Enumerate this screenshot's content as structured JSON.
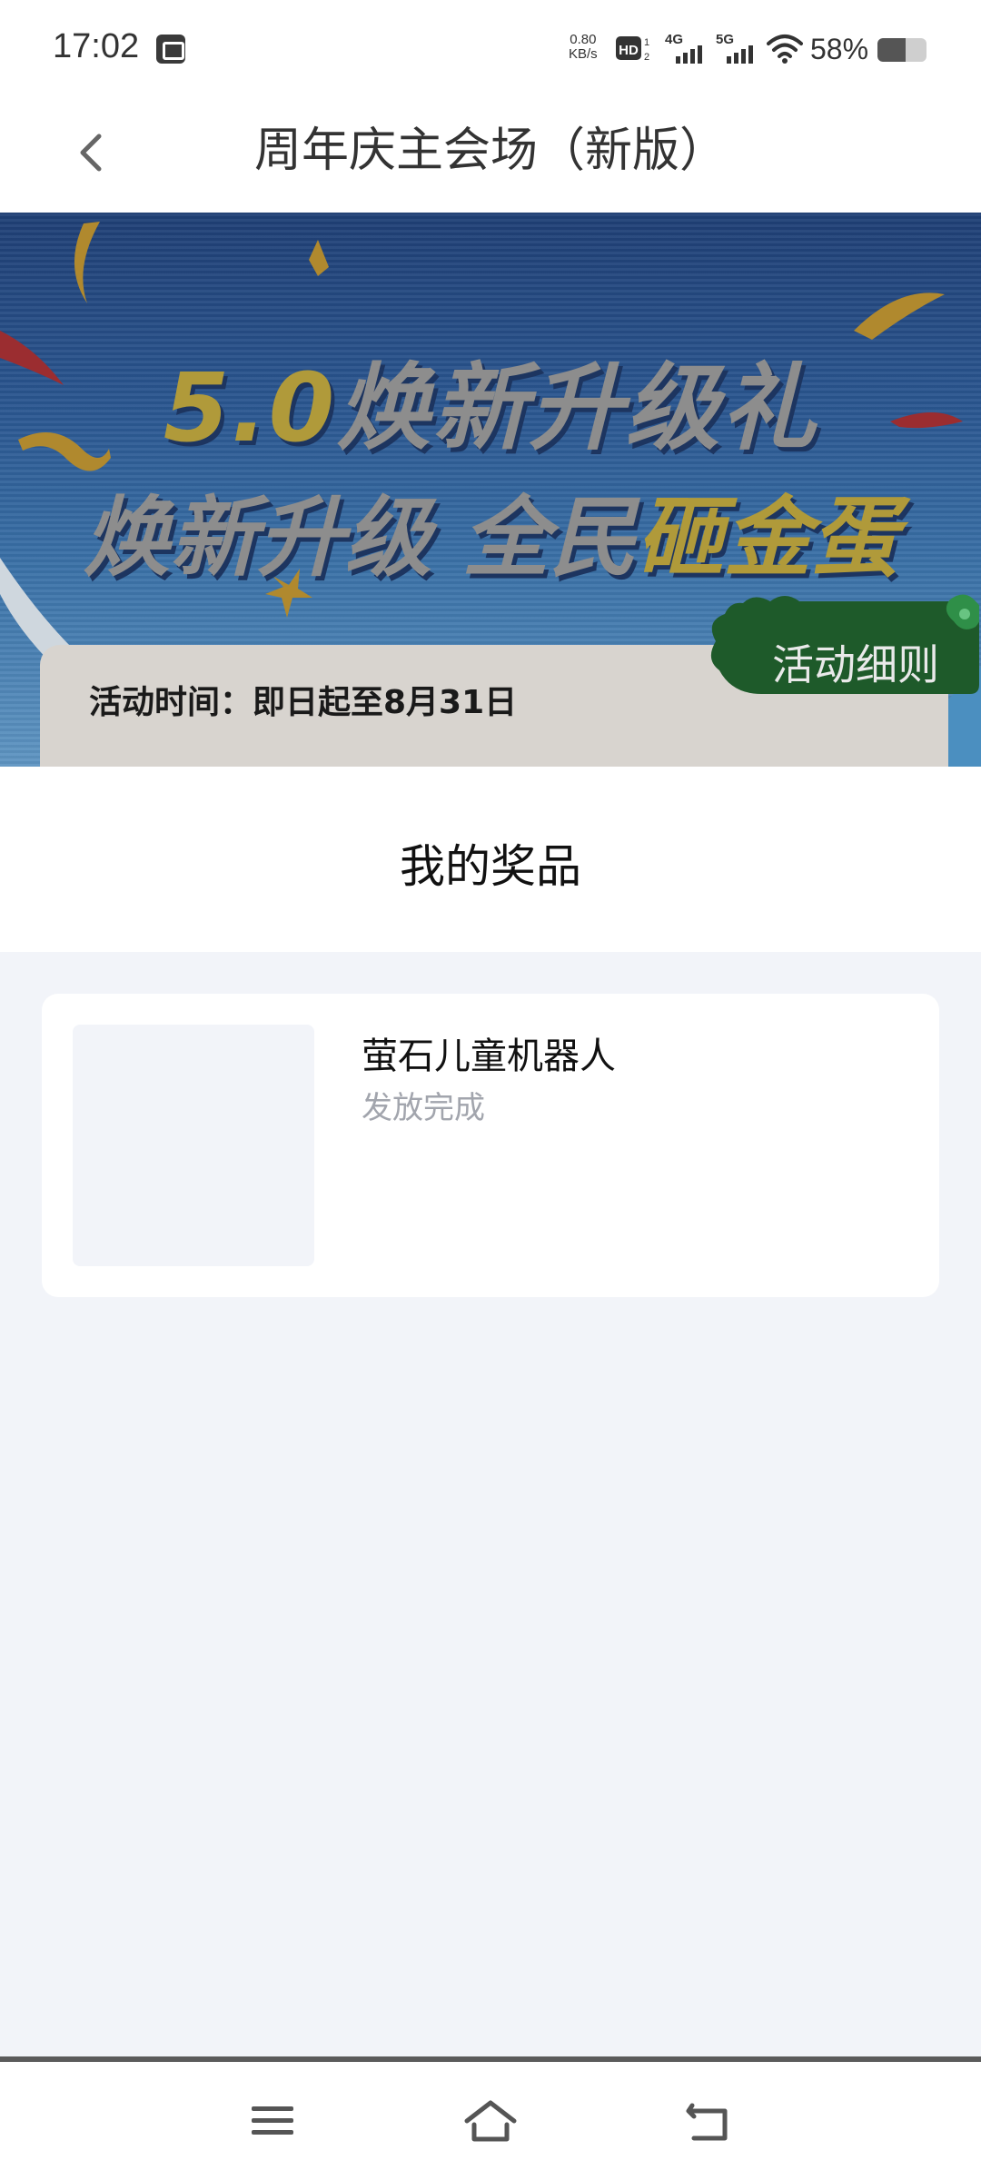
{
  "status_bar": {
    "time": "17:02",
    "net_speed_value": "0.80",
    "net_speed_unit": "KB/s",
    "hd_label": "HD",
    "sim1_label": "4G",
    "sim2_label": "5G",
    "battery": "58%",
    "battery_level": 0.58
  },
  "title_bar": {
    "title": "周年庆主会场（新版）"
  },
  "banner": {
    "headline1_accent": "5.0",
    "headline1_rest": "焕新升级礼",
    "headline2_part1": "焕新升级 全民",
    "headline2_accent": "砸金蛋",
    "activity_time": "活动时间：即日起至8月31日",
    "rules_button": "活动细则"
  },
  "section": {
    "title": "我的奖品"
  },
  "prizes": [
    {
      "name": "萤石儿童机器人",
      "status": "发放完成"
    }
  ],
  "colors": {
    "background": "#f2f4f9",
    "gold": "#b09a3a",
    "rules_green": "#1e5a2a",
    "muted_text": "#a2a5ad"
  },
  "icons": {
    "back": "chevron-left-icon",
    "menu": "menu-icon",
    "home": "home-icon",
    "return": "return-icon"
  }
}
